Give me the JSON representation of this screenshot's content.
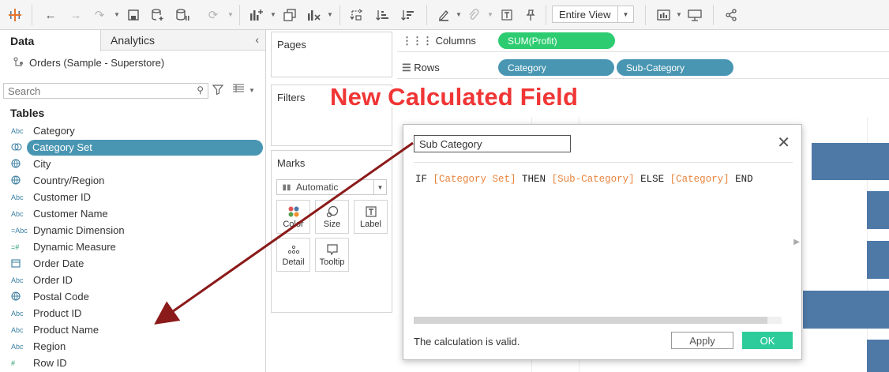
{
  "toolbar": {
    "icons": [
      "tableau-logo-icon",
      "back-icon",
      "forward-icon",
      "redo-icon",
      "save-icon",
      "new-datasource-icon",
      "pause-updates-icon",
      "refresh-icon",
      "new-worksheet-icon",
      "duplicate-icon",
      "clear-sheet-icon",
      "swap-icon",
      "sort-ascending-icon",
      "sort-descending-icon",
      "highlight-icon",
      "group-icon",
      "show-labels-icon",
      "pin-icon",
      "show-me-icon",
      "presentation-icon",
      "share-icon"
    ],
    "view_mode": "Entire View"
  },
  "data_pane": {
    "tabs": [
      {
        "label": "Data"
      },
      {
        "label": "Analytics"
      }
    ],
    "datasource": "Orders (Sample - Superstore)",
    "search_placeholder": "Search",
    "tables_heading": "Tables",
    "fields": [
      {
        "type": "Abc",
        "label": "Category"
      },
      {
        "type": "set",
        "label": "Category Set",
        "selected": true
      },
      {
        "type": "geo",
        "label": "City"
      },
      {
        "type": "geo",
        "label": "Country/Region"
      },
      {
        "type": "Abc",
        "label": "Customer ID"
      },
      {
        "type": "Abc",
        "label": "Customer Name"
      },
      {
        "type": "=Abc",
        "label": "Dynamic Dimension"
      },
      {
        "type": "=#",
        "label": "Dynamic Measure"
      },
      {
        "type": "date",
        "label": "Order Date"
      },
      {
        "type": "Abc",
        "label": "Order ID"
      },
      {
        "type": "geo",
        "label": "Postal Code"
      },
      {
        "type": "Abc",
        "label": "Product ID"
      },
      {
        "type": "Abc",
        "label": "Product Name"
      },
      {
        "type": "Abc",
        "label": "Region"
      },
      {
        "type": "#",
        "label": "Row ID"
      }
    ]
  },
  "cards": {
    "pages": "Pages",
    "filters": "Filters",
    "marks": "Marks",
    "marks_type": "Automatic",
    "mark_buttons": [
      {
        "label": "Color",
        "icon": "color-icon"
      },
      {
        "label": "Size",
        "icon": "size-icon"
      },
      {
        "label": "Label",
        "icon": "label-icon"
      },
      {
        "label": "Detail",
        "icon": "detail-icon"
      },
      {
        "label": "Tooltip",
        "icon": "tooltip-icon"
      }
    ]
  },
  "shelves": {
    "columns_label": "Columns",
    "rows_label": "Rows",
    "columns_pills": [
      "SUM(Profit)"
    ],
    "rows_pills": [
      "Category",
      "Sub-Category"
    ],
    "pill_colors": {
      "measure": "#2ecc71",
      "dimension": "#4996b2"
    }
  },
  "annotation": "New Calculated Field",
  "calc_dialog": {
    "name": "Sub Category",
    "formula": [
      {
        "text": "IF ",
        "kind": "keyword"
      },
      {
        "text": "[Category Set]",
        "kind": "field"
      },
      {
        "text": " THEN ",
        "kind": "keyword"
      },
      {
        "text": "[Sub-Category]",
        "kind": "field"
      },
      {
        "text": " ELSE ",
        "kind": "keyword"
      },
      {
        "text": "[Category]",
        "kind": "field"
      },
      {
        "text": " END",
        "kind": "keyword"
      }
    ],
    "status": "The calculation is valid.",
    "apply_label": "Apply",
    "ok_label": "OK"
  },
  "colors": {
    "accent_pill": "#4996b2",
    "ok_button": "#2ecc9a",
    "annotation": "#f03535",
    "arrow": "#8b1a1a",
    "bar": "#4e79a7",
    "formula_field": "#e8843d"
  }
}
